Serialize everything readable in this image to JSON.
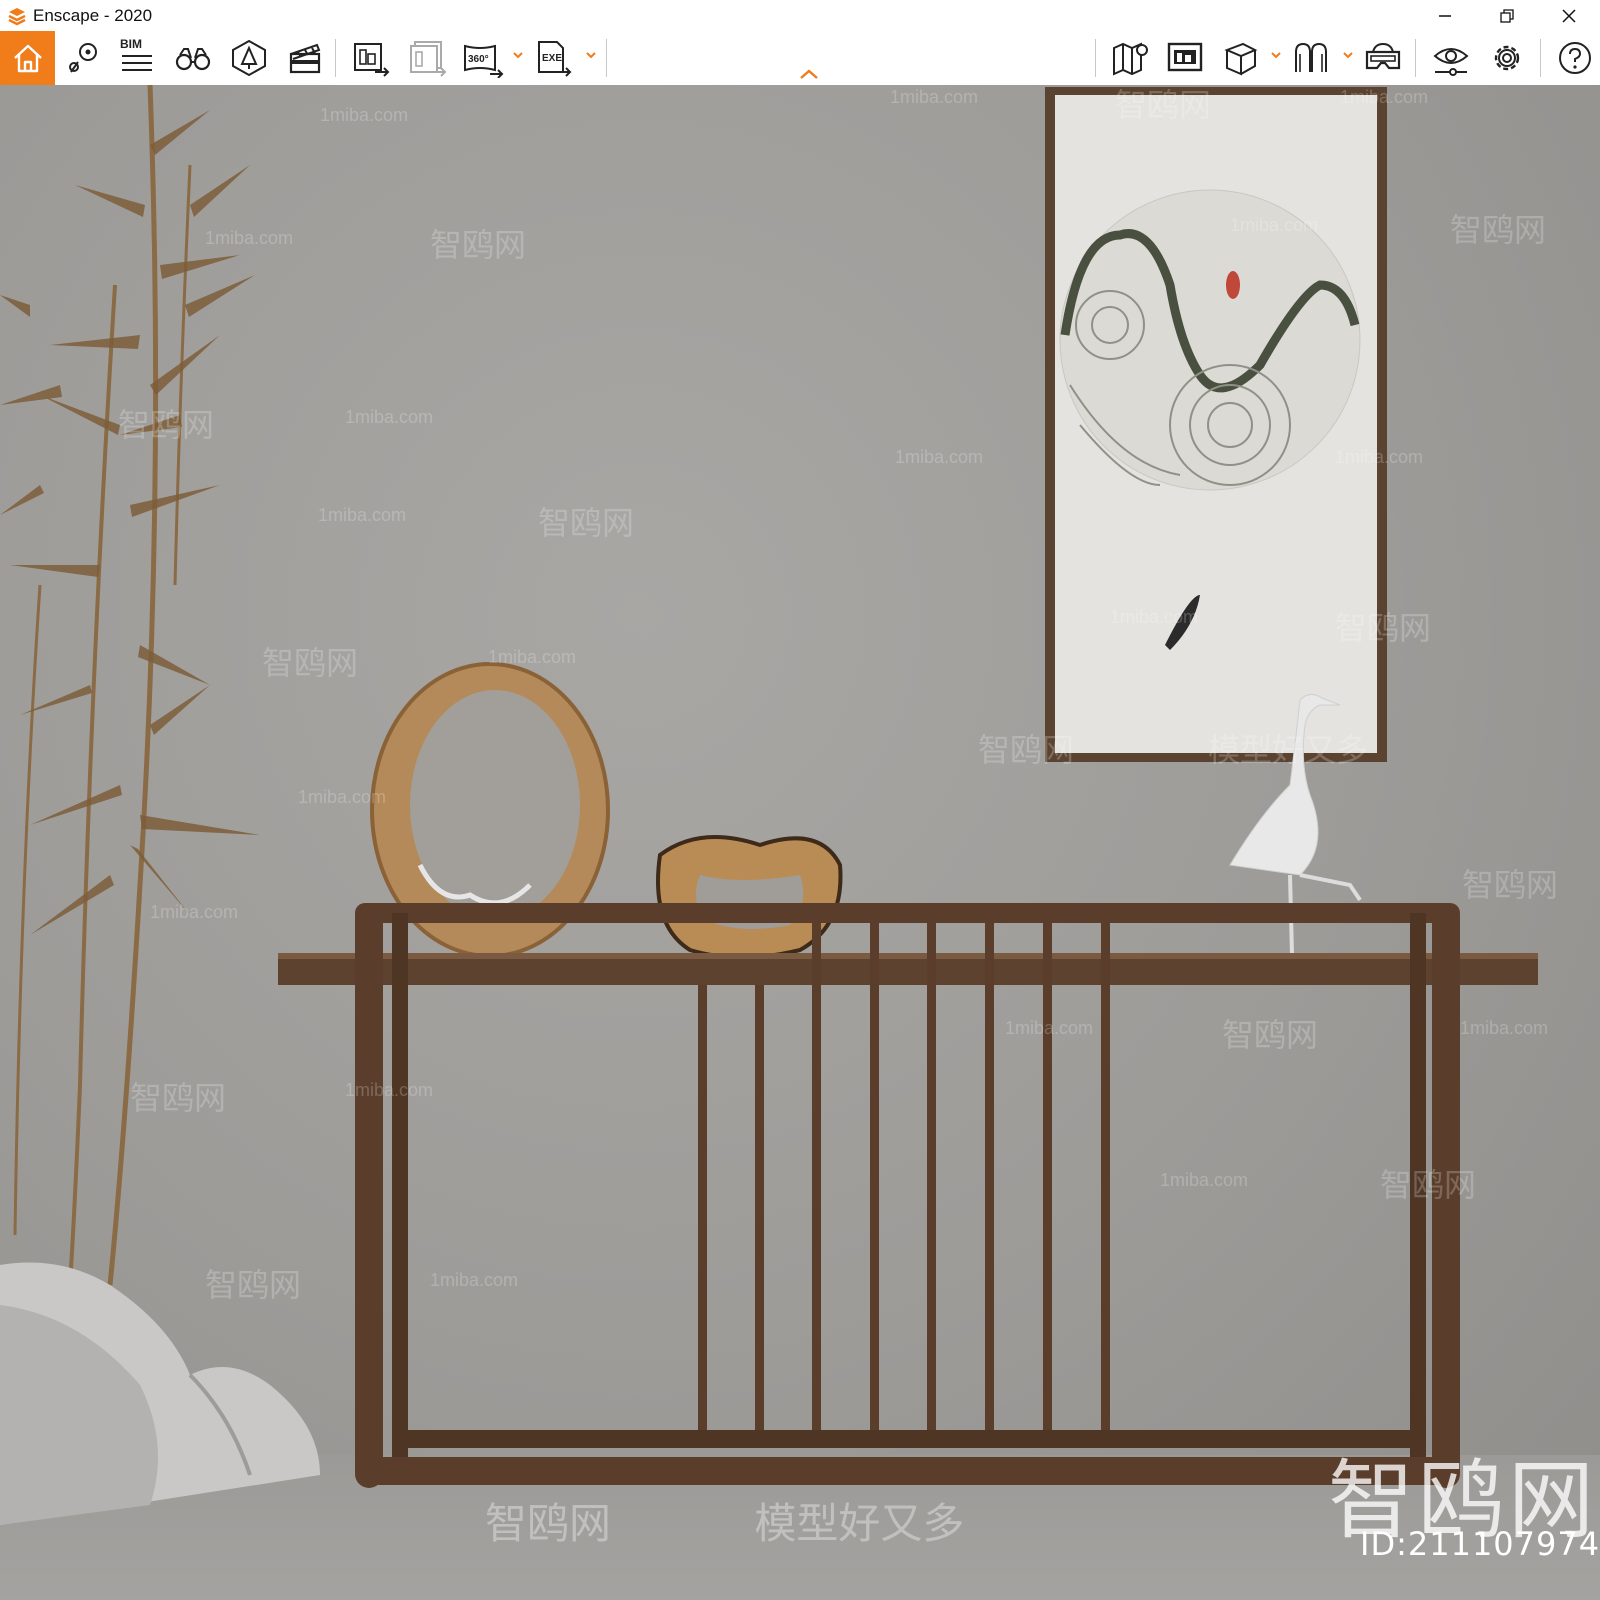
{
  "window": {
    "title": "Enscape - 2020",
    "controls": [
      "minimize-icon",
      "restore-icon",
      "close-icon"
    ]
  },
  "toolbar": {
    "accent": "#f07c1a",
    "left_tools": [
      {
        "name": "home",
        "icon": "home-icon"
      },
      {
        "name": "views",
        "icon": "location-pin-icon"
      },
      {
        "name": "bim",
        "icon": "bim-list-icon",
        "label": "BIM"
      },
      {
        "name": "walk-mode",
        "icon": "binoculars-icon"
      },
      {
        "name": "asset-library",
        "icon": "asset-library-icon"
      },
      {
        "name": "video-editor",
        "icon": "clapperboard-icon"
      },
      {
        "name": "screenshot",
        "icon": "render-export-icon"
      },
      {
        "name": "batch-render",
        "icon": "batch-render-icon"
      },
      {
        "name": "panorama",
        "icon": "panorama-360-icon",
        "label": "360°"
      },
      {
        "name": "export-exe",
        "icon": "export-exe-icon",
        "label": "EXE"
      }
    ],
    "right_tools": [
      {
        "name": "map",
        "icon": "map-icon"
      },
      {
        "name": "capture",
        "icon": "capture-icon"
      },
      {
        "name": "view-cube",
        "icon": "cube-icon"
      },
      {
        "name": "vr",
        "icon": "vr-icon"
      },
      {
        "name": "headset",
        "icon": "headset-icon"
      },
      {
        "name": "visual-settings",
        "icon": "eye-settings-icon"
      },
      {
        "name": "settings",
        "icon": "gear-icon"
      },
      {
        "name": "help",
        "icon": "help-icon"
      }
    ]
  },
  "watermark": {
    "site": "1miba.com",
    "brand": "智鸥网",
    "slogan": "模型好又多",
    "big_logo": "智鸥网",
    "id": "ID:211107974"
  }
}
